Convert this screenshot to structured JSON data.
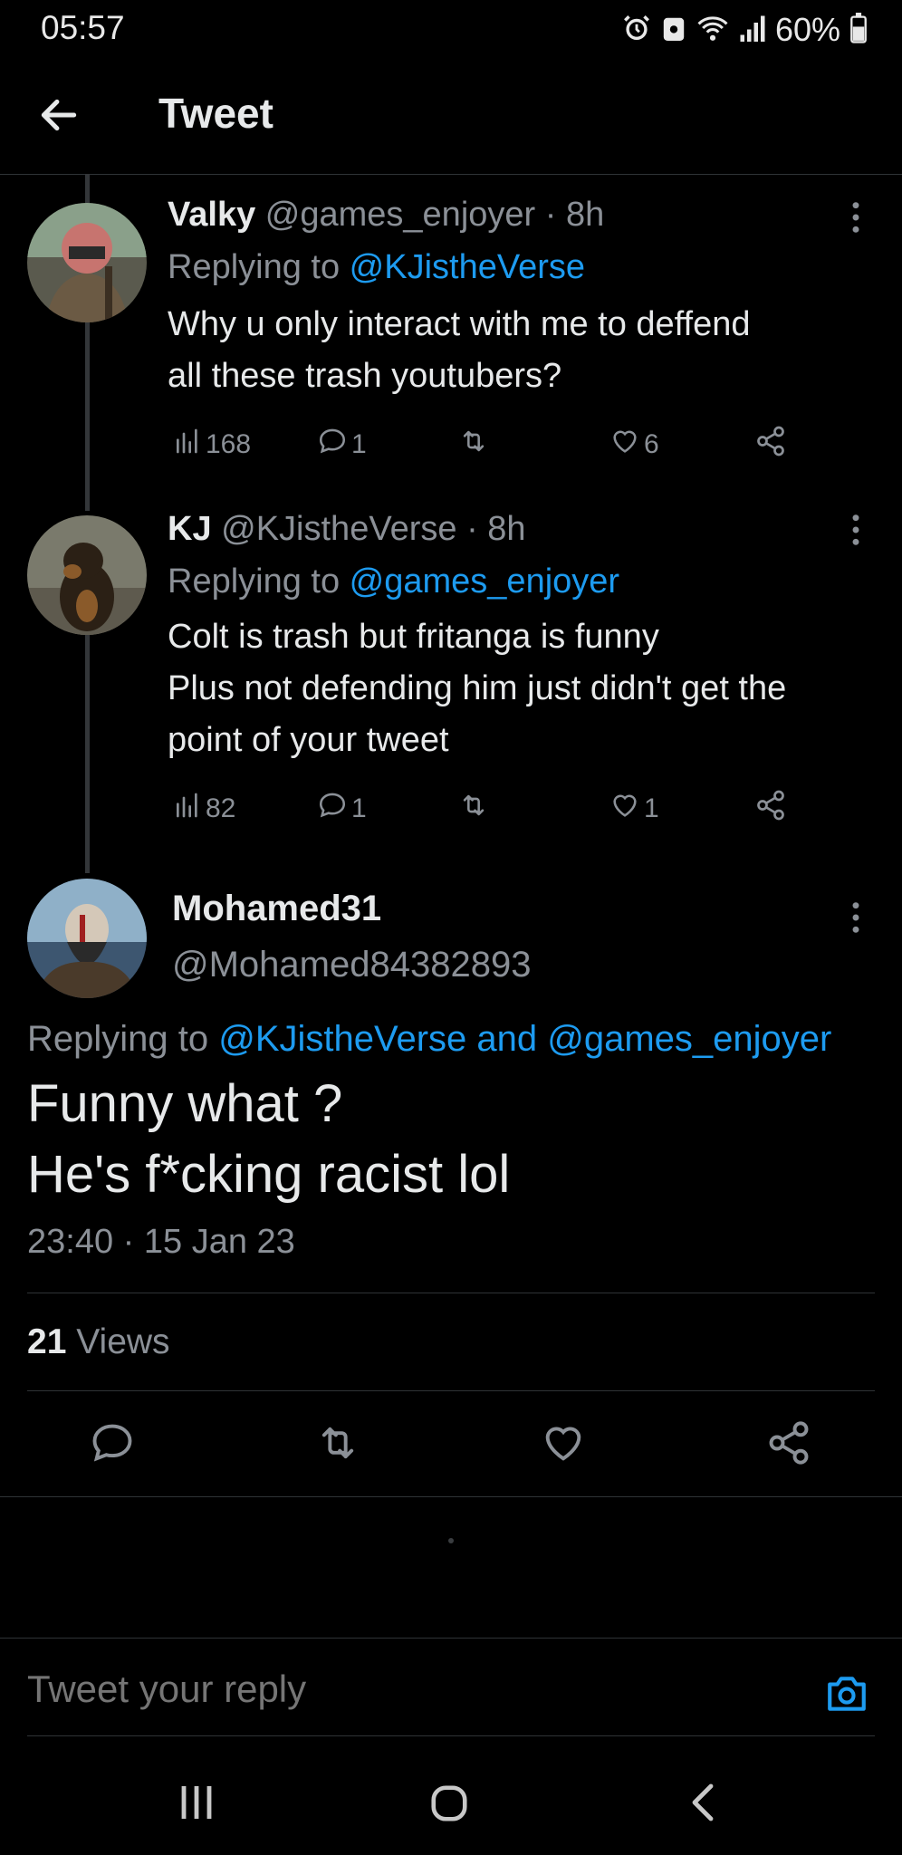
{
  "status_bar": {
    "time": "05:57",
    "battery": "60%",
    "icons": [
      "alarm-icon",
      "notification-icon",
      "wifi-icon",
      "signal-icon",
      "battery-icon"
    ]
  },
  "header": {
    "title": "Tweet",
    "back_icon": "arrow-left-icon"
  },
  "thread": [
    {
      "name": "Valky",
      "handle": "@games_enjoyer",
      "time": "· 8h",
      "replying_prefix": "Replying to ",
      "replying_to": "@KJistheVerse",
      "text_lines": [
        "Why u only interact with me to deffend",
        "all these trash youtubers?"
      ],
      "views": "168",
      "replies": "1",
      "retweets": "",
      "likes": "6"
    },
    {
      "name": "KJ",
      "handle": "@KJistheVerse",
      "time": "· 8h",
      "replying_prefix": "Replying to ",
      "replying_to": "@games_enjoyer",
      "text_lines": [
        "Colt is trash but fritanga is funny",
        "Plus not defending him just didn't get the",
        "point of your tweet"
      ],
      "views": "82",
      "replies": "1",
      "retweets": "",
      "likes": "1"
    }
  ],
  "main_tweet": {
    "name": "Mohamed31",
    "handle": "@Mohamed84382893",
    "replying_prefix": "Replying to ",
    "replying_to": "@KJistheVerse and @games_enjoyer",
    "text_lines": [
      "Funny what ?",
      "He's f*cking racist lol"
    ],
    "timestamp": "23:40 · 15 Jan 23",
    "views_count": "21",
    "views_label": " Views"
  },
  "reply": {
    "placeholder": "Tweet your reply"
  },
  "colors": {
    "background": "#000000",
    "text": "#e7e9ea",
    "muted": "#8b9097",
    "link": "#1d9bf0",
    "divider": "#2f3336"
  }
}
